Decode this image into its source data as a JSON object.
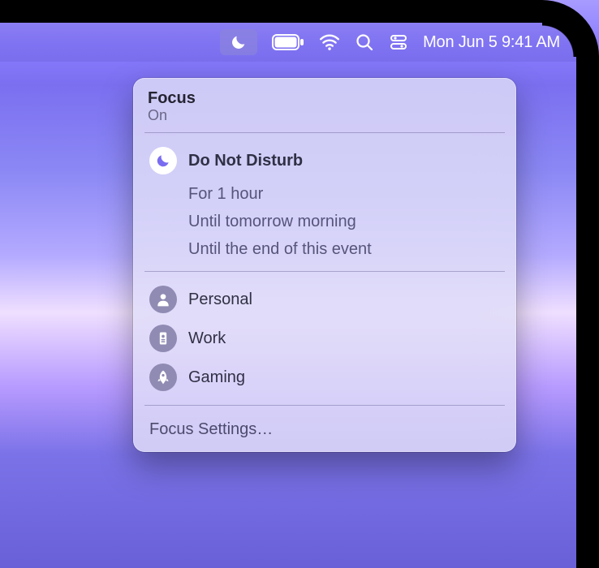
{
  "menubar": {
    "clock": "Mon Jun 5  9:41 AM",
    "icons": {
      "focus": "moon-icon",
      "battery": "battery-icon",
      "wifi": "wifi-icon",
      "search": "search-icon",
      "control_center": "control-center-icon"
    }
  },
  "panel": {
    "title": "Focus",
    "status": "On",
    "dnd": {
      "label": "Do Not Disturb",
      "options": [
        "For 1 hour",
        "Until tomorrow morning",
        "Until the end of this event"
      ]
    },
    "modes": [
      {
        "name": "Personal",
        "icon": "person-icon"
      },
      {
        "name": "Work",
        "icon": "badge-icon"
      },
      {
        "name": "Gaming",
        "icon": "rocket-icon"
      }
    ],
    "settings": "Focus Settings…"
  }
}
